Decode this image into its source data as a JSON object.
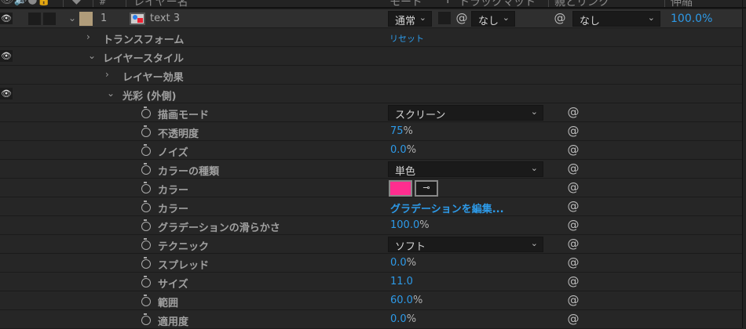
{
  "header": {
    "number": "#",
    "layer_name": "レイヤー名",
    "mode": "モード",
    "t": "T",
    "track_matte": "トラックマット",
    "parent": "親とリンク",
    "stretch": "伸縮"
  },
  "layer": {
    "number": "1",
    "name": "text 3",
    "label_color": "#b09c7a",
    "mode": "通常",
    "track_matte": "なし",
    "parent": "なし",
    "stretch": "100.0%"
  },
  "transform": {
    "label": "トランスフォーム",
    "reset": "リセット"
  },
  "layer_style": {
    "label": "レイヤースタイル"
  },
  "layer_effect": {
    "label": "レイヤー効果"
  },
  "outer_glow": {
    "label": "光彩 (外側)"
  },
  "props": [
    {
      "label": "描画モード",
      "dropdown": "スクリーン"
    },
    {
      "label": "不透明度",
      "value": "75",
      "unit": "%"
    },
    {
      "label": "ノイズ",
      "value": "0.0",
      "unit": "%"
    },
    {
      "label": "カラーの種類",
      "dropdown": "単色"
    },
    {
      "label": "カラー",
      "color": "#ff2d8f"
    },
    {
      "label": "カラー",
      "link": "グラデーションを編集..."
    },
    {
      "label": "グラデーションの滑らかさ",
      "value": "100.0",
      "unit": "%"
    },
    {
      "label": "テクニック",
      "dropdown": "ソフト"
    },
    {
      "label": "スプレッド",
      "value": "0.0",
      "unit": "%"
    },
    {
      "label": "サイズ",
      "value": "11.0",
      "unit": ""
    },
    {
      "label": "範囲",
      "value": "60.0",
      "unit": "%"
    },
    {
      "label": "適用度",
      "value": "0.0",
      "unit": "%"
    }
  ]
}
